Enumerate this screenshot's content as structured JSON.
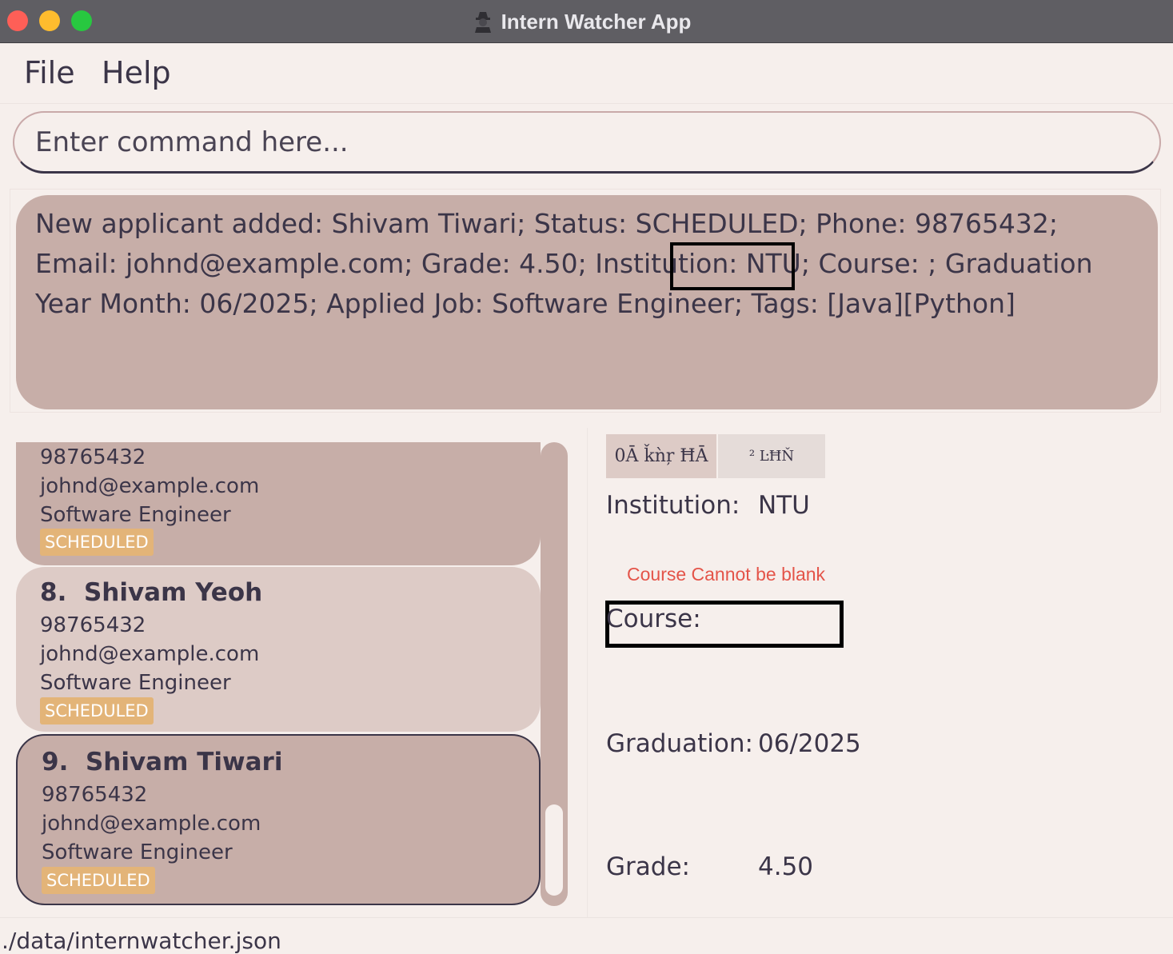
{
  "window": {
    "title": "Intern Watcher App"
  },
  "menu": {
    "items": [
      "File",
      "Help"
    ]
  },
  "command": {
    "placeholder": "Enter command here...",
    "value": ""
  },
  "result": {
    "message": "New applicant added: Shivam Tiwari; Status: SCHEDULED; Phone: 98765432; Email: johnd@example.com; Grade: 4.50; Institution: NTU; Course: ; Graduation Year Month: 06/2025; Applied Job: Software Engineer; Tags: [Java][Python]"
  },
  "applicant_list": {
    "cards": [
      {
        "index": "",
        "name": "",
        "phone": "98765432",
        "email": "johnd@example.com",
        "job": "Software Engineer",
        "status": "SCHEDULED"
      },
      {
        "index": "8.",
        "name": "Shivam Yeoh",
        "phone": "98765432",
        "email": "johnd@example.com",
        "job": "Software Engineer",
        "status": "SCHEDULED"
      },
      {
        "index": "9.",
        "name": "Shivam Tiwari",
        "phone": "98765432",
        "email": "johnd@example.com",
        "job": "Software Engineer",
        "status": "SCHEDULED",
        "selected": true
      }
    ]
  },
  "detail": {
    "tabs": [
      "0Ā ǩǹŗ ĦĀ",
      "² ĿĦŇ"
    ],
    "institution": {
      "label": "Institution:",
      "value": "NTU"
    },
    "course_error": "Course Cannot be blank",
    "course": {
      "label": "Course:",
      "value": ""
    },
    "graduation": {
      "label": "Graduation:",
      "value": "06/2025"
    },
    "grade": {
      "label": "Grade:",
      "value": "4.50"
    }
  },
  "status_bar": {
    "path": "./data/internwatcher.json"
  },
  "colors": {
    "background": "#f6efec",
    "card": "#c7aea8",
    "card_alt": "#ddcbc6",
    "badge": "#e3b478",
    "error": "#e45449",
    "text": "#3b3548"
  }
}
